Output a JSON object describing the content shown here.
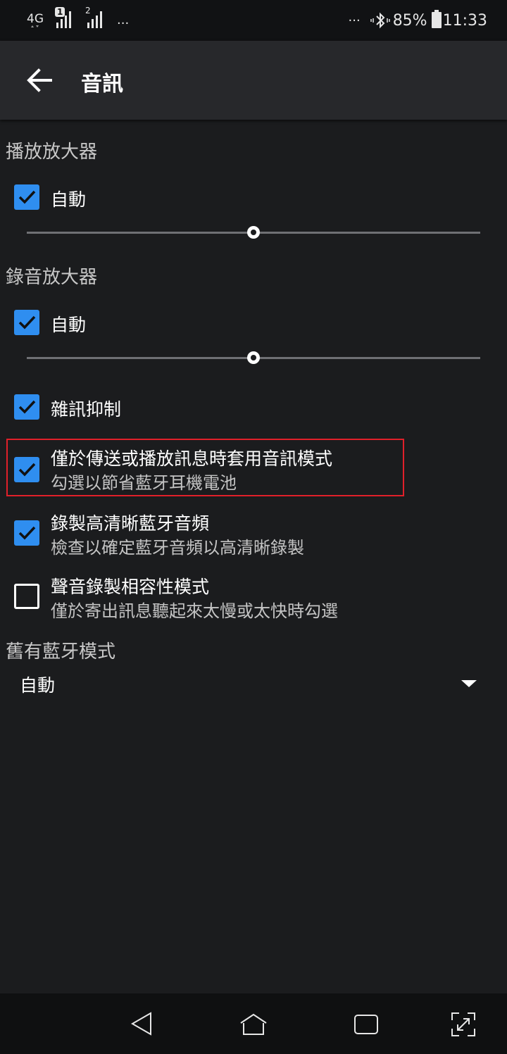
{
  "status_bar": {
    "network": "4G",
    "sim1": "1",
    "sim2": "2",
    "left_dots": "···",
    "right_dots": "···",
    "battery": "85%",
    "time": "11:33"
  },
  "app_bar": {
    "title": "音訊"
  },
  "playback_amp": {
    "header": "播放放大器",
    "auto_label": "自動",
    "auto_checked": true,
    "slider_level": 0.5
  },
  "record_amp": {
    "header": "錄音放大器",
    "auto_label": "自動",
    "auto_checked": true,
    "slider_level": 0.5
  },
  "noise_suppression": {
    "label": "雜訊抑制",
    "checked": true
  },
  "audio_mode_option": {
    "label": "僅於傳送或播放訊息時套用音訊模式",
    "sub": "勾選以節省藍牙耳機電池",
    "checked": true
  },
  "hd_bluetooth": {
    "label": "錄製高清晰藍牙音頻",
    "sub": "檢查以確定藍牙音頻以高清晰錄製",
    "checked": true
  },
  "compat_mode": {
    "label": "聲音錄製相容性模式",
    "sub": "僅於寄出訊息聽起來太慢或太快時勾選",
    "checked": false
  },
  "legacy_bt": {
    "header": "舊有藍牙模式",
    "value": "自動"
  },
  "colors": {
    "accent": "#2f8ef0",
    "highlight": "#e0202a",
    "background": "#1b1c1e"
  },
  "icons": {
    "back": "arrow-left-icon",
    "nav_back": "triangle-back-icon",
    "nav_home": "home-icon",
    "nav_recents": "recents-icon",
    "nav_screenshot": "expand-icon"
  }
}
